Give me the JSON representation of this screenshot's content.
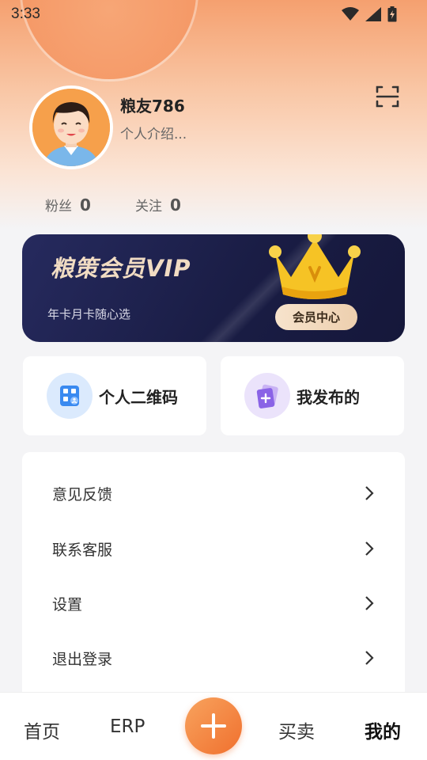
{
  "status_bar": {
    "time": "3:33"
  },
  "profile": {
    "nickname": "粮友786",
    "bio": "个人介绍...",
    "fans_label": "粉丝",
    "fans_count": "0",
    "follow_label": "关注",
    "follow_count": "0"
  },
  "vip": {
    "title": "粮策会员VIP",
    "subtitle": "年卡月卡随心选",
    "button_label": "会员中心"
  },
  "quick_actions": [
    {
      "label": "个人二维码",
      "icon": "qrcode-icon"
    },
    {
      "label": "我发布的",
      "icon": "publish-icon"
    }
  ],
  "menu": [
    {
      "label": "意见反馈"
    },
    {
      "label": "联系客服"
    },
    {
      "label": "设置"
    },
    {
      "label": "退出登录"
    }
  ],
  "tabbar": {
    "home": "首页",
    "erp": "ERP",
    "trade": "买卖",
    "mine": "我的",
    "active": "mine"
  },
  "colors": {
    "accent": "#f0702e",
    "vip_bg": "#1a1d45",
    "vip_gold": "#f1dcc3"
  }
}
